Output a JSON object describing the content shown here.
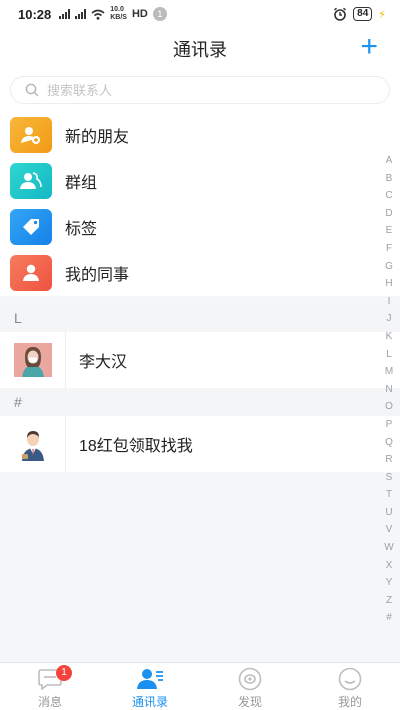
{
  "status_bar": {
    "time": "10:28",
    "network_speed_top": "10.0",
    "network_speed_bottom": "KB/S",
    "hd": "HD",
    "notification_count": "1",
    "battery": "84"
  },
  "header": {
    "title": "通讯录",
    "add_label": "+"
  },
  "search": {
    "placeholder": "搜索联系人"
  },
  "functions": [
    {
      "label": "新的朋友",
      "icon": "new-friend-icon",
      "color": "#f5a623"
    },
    {
      "label": "群组",
      "icon": "group-icon",
      "color": "#1ec8c8"
    },
    {
      "label": "标签",
      "icon": "tag-icon",
      "color": "#1e90f0"
    },
    {
      "label": "我的同事",
      "icon": "colleague-icon",
      "color": "#f36a4f"
    }
  ],
  "sections": [
    {
      "letter": "L",
      "contacts": [
        {
          "name": "李大汉",
          "avatar": "woman-avatar"
        }
      ]
    },
    {
      "letter": "#",
      "contacts": [
        {
          "name": "18红包领取找我",
          "avatar": "man-avatar"
        }
      ]
    }
  ],
  "alphabet": [
    "A",
    "B",
    "C",
    "D",
    "E",
    "F",
    "G",
    "H",
    "I",
    "J",
    "K",
    "L",
    "M",
    "N",
    "O",
    "P",
    "Q",
    "R",
    "S",
    "T",
    "U",
    "V",
    "W",
    "X",
    "Y",
    "Z",
    "#"
  ],
  "tabbar": {
    "tabs": [
      {
        "label": "消息",
        "icon": "message-icon",
        "badge": "1",
        "active": false
      },
      {
        "label": "通讯录",
        "icon": "contacts-icon",
        "active": true
      },
      {
        "label": "发现",
        "icon": "discover-icon",
        "active": false
      },
      {
        "label": "我的",
        "icon": "profile-icon",
        "active": false
      }
    ],
    "active_color": "#1a90f0"
  }
}
